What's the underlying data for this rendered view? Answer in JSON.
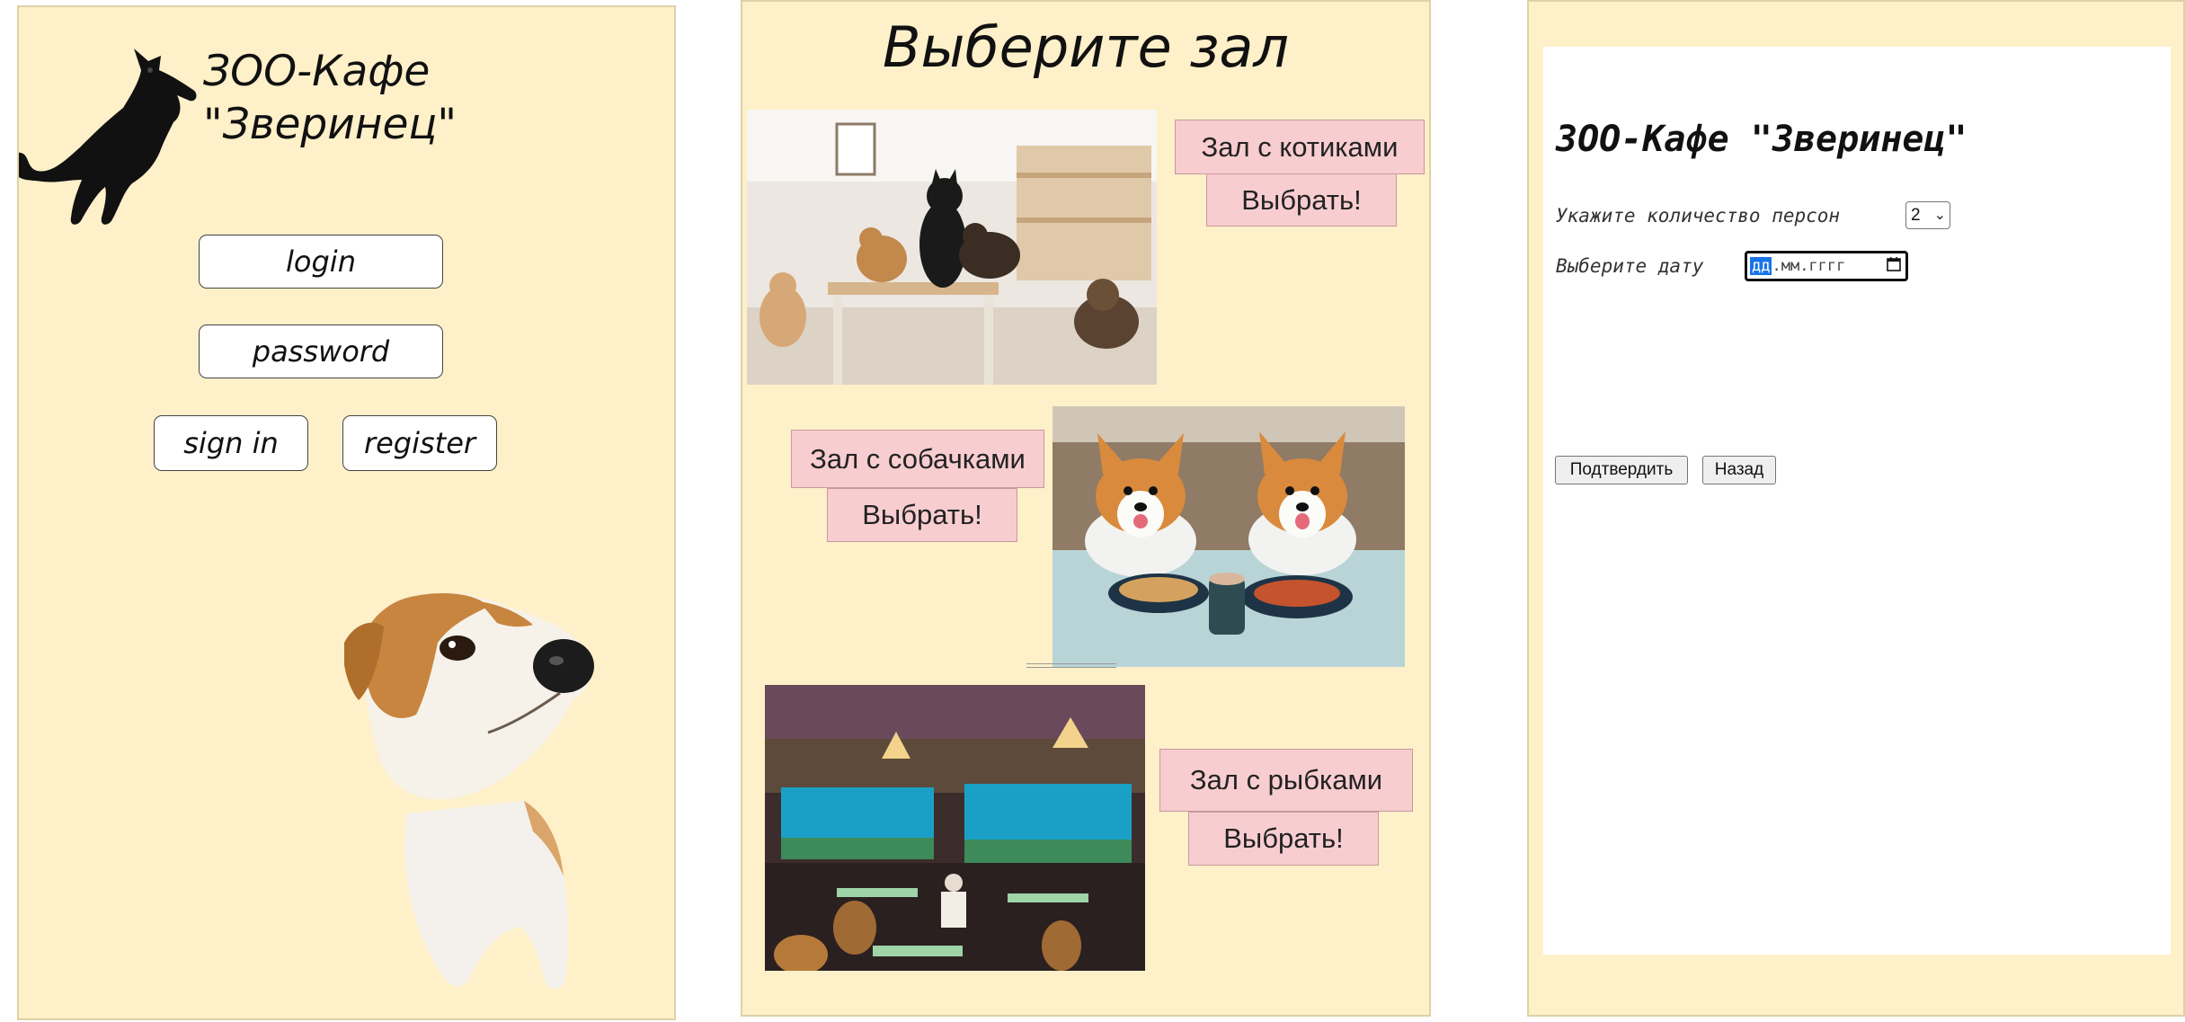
{
  "login_screen": {
    "title_line1": "ЗОО-Кафе",
    "title_line2": "\"Зверинец\"",
    "login_placeholder": "login",
    "password_placeholder": "password",
    "sign_in_label": "sign in",
    "register_label": "register"
  },
  "hall_screen": {
    "title": "Выберите зал",
    "halls": [
      {
        "label": "Зал с котиками",
        "button": "Выбрать!"
      },
      {
        "label": "Зал с собачками",
        "button": "Выбрать!"
      },
      {
        "label": "Зал с рыбками",
        "button": "Выбрать!"
      }
    ]
  },
  "booking_form": {
    "title": "ЗОО-Кафе \"Зверинец\"",
    "persons_label": "Укажите количество персон",
    "persons_value": "2",
    "date_label": "Выберите дату",
    "date_placeholder_day": "дд",
    "date_placeholder_rest": ".мм.гггг",
    "confirm_label": "Подтвердить",
    "back_label": "Назад"
  },
  "colors": {
    "panel_bg": "#fef0c9",
    "hall_label_bg": "#f8cdd0",
    "date_highlight": "#1a73e8"
  },
  "icons": [
    "cat-illustration",
    "dog-illustration",
    "chevron-down-icon",
    "calendar-icon"
  ]
}
